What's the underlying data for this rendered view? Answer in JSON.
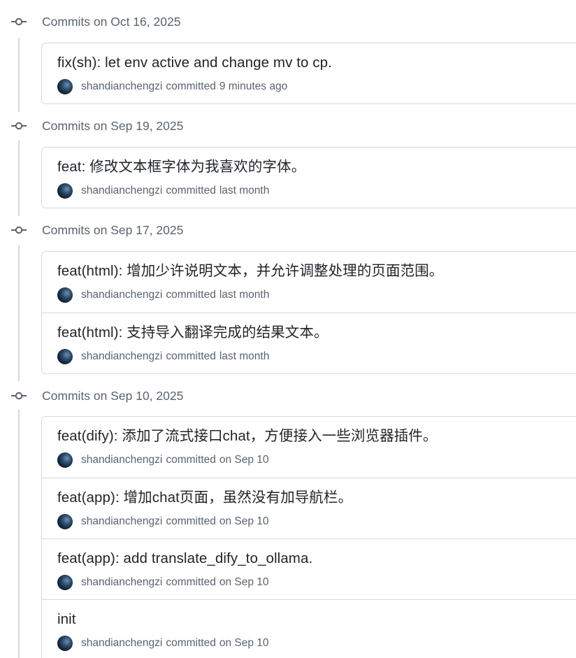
{
  "groups": [
    {
      "title": "Commits on Oct 16, 2025",
      "commits": [
        {
          "message": "fix(sh): let env active and change mv to cp.",
          "author": "shandianchengzi",
          "action": "committed",
          "time": "9 minutes ago"
        }
      ]
    },
    {
      "title": "Commits on Sep 19, 2025",
      "commits": [
        {
          "message": "feat: 修改文本框字体为我喜欢的字体。",
          "author": "shandianchengzi",
          "action": "committed",
          "time": "last month"
        }
      ]
    },
    {
      "title": "Commits on Sep 17, 2025",
      "commits": [
        {
          "message": "feat(html): 增加少许说明文本，并允许调整处理的页面范围。",
          "author": "shandianchengzi",
          "action": "committed",
          "time": "last month"
        },
        {
          "message": "feat(html): 支持导入翻译完成的结果文本。",
          "author": "shandianchengzi",
          "action": "committed",
          "time": "last month"
        }
      ]
    },
    {
      "title": "Commits on Sep 10, 2025",
      "commits": [
        {
          "message": "feat(dify): 添加了流式接口chat，方便接入一些浏览器插件。",
          "author": "shandianchengzi",
          "action": "committed",
          "time": "on Sep 10"
        },
        {
          "message": "feat(app): 增加chat页面，虽然没有加导航栏。",
          "author": "shandianchengzi",
          "action": "committed",
          "time": "on Sep 10"
        },
        {
          "message": "feat(app): add translate_dify_to_ollama.",
          "author": "shandianchengzi",
          "action": "committed",
          "time": "on Sep 10"
        },
        {
          "message": "init",
          "author": "shandianchengzi",
          "action": "committed",
          "time": "on Sep 10"
        }
      ]
    }
  ]
}
